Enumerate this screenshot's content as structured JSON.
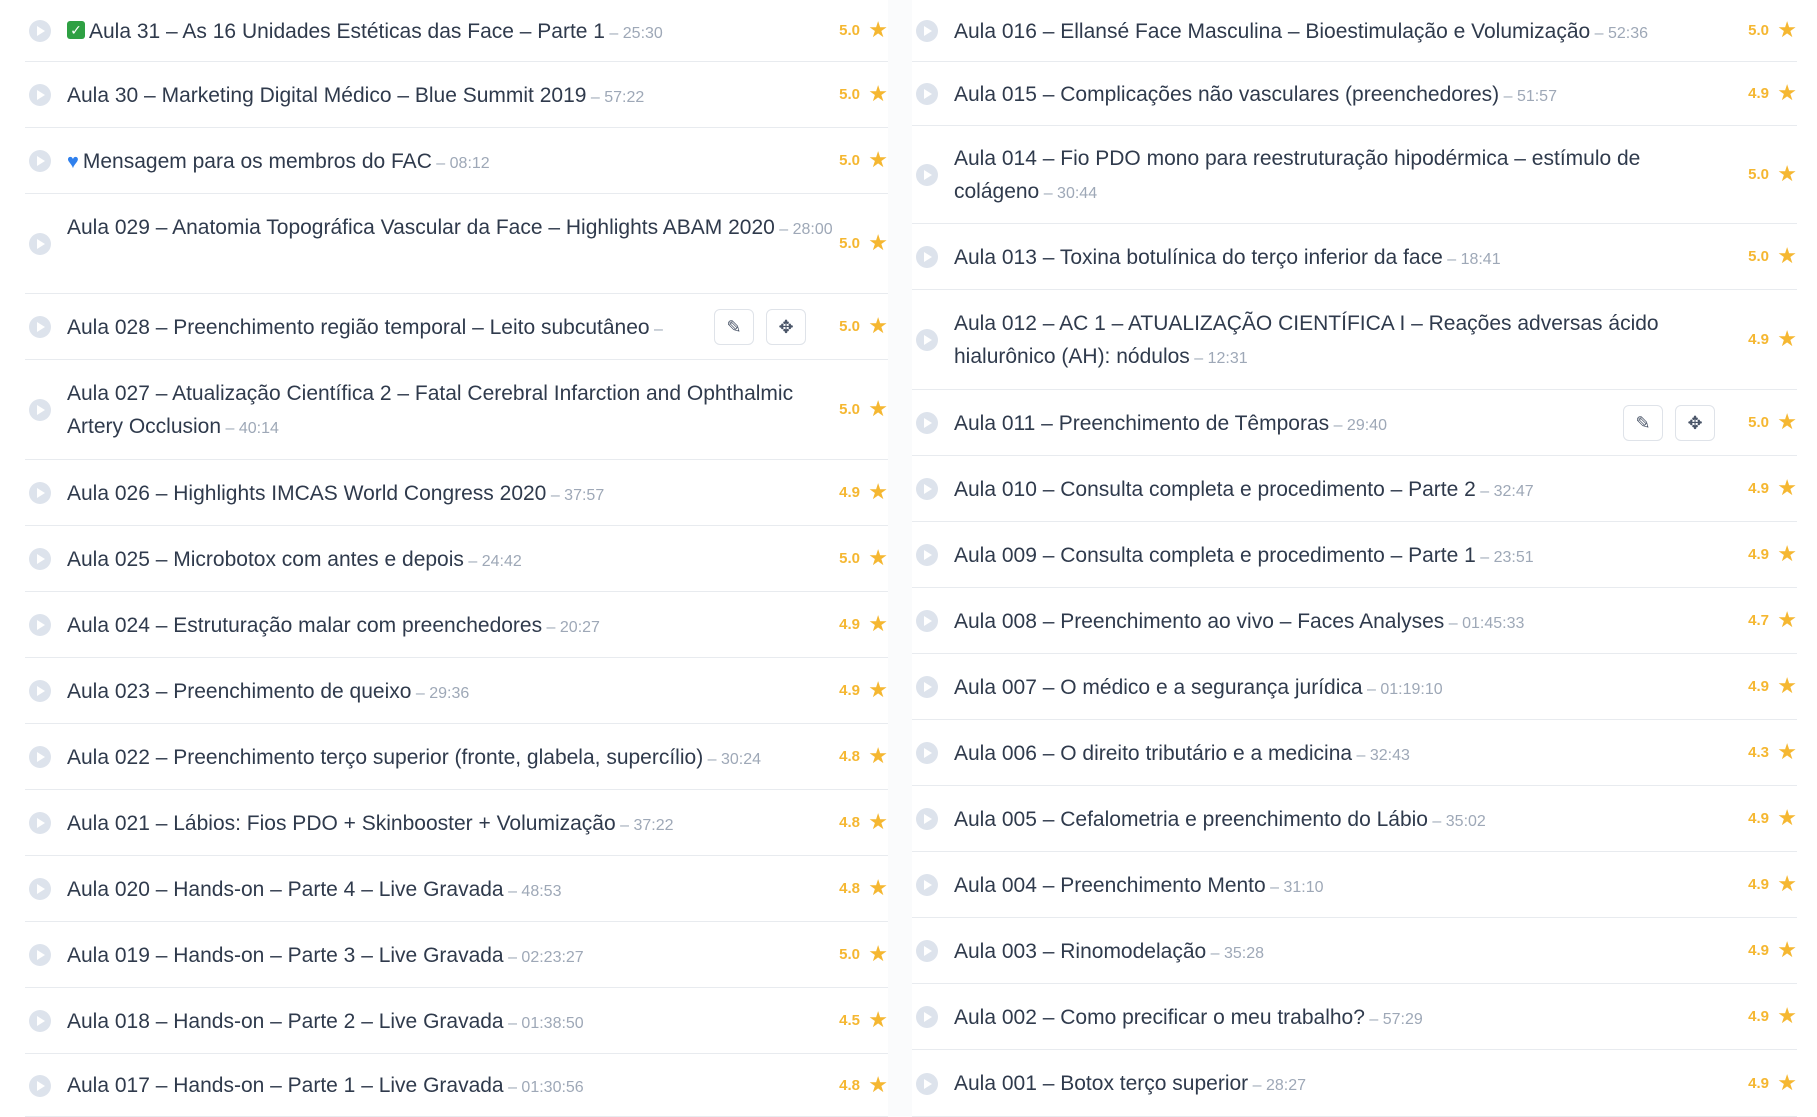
{
  "colors": {
    "accent_star": "#f5b731",
    "text": "#2f3a4c",
    "muted": "#9ea8b7",
    "divider": "#e8ebef"
  },
  "icons": {
    "play": "play-circle-icon",
    "star": "star-icon",
    "edit": "edit-icon",
    "move": "move-icon",
    "check": "check-mark-emoji-icon",
    "heart": "blue-heart-emoji-icon"
  },
  "left_column": [
    {
      "title": "Aula 31 – As 16 Unidades Estéticas das Face – Parte 1",
      "duration": "25:30",
      "rating": "5.0",
      "emoji": "check"
    },
    {
      "title": "Aula 30 – Marketing Digital Médico – Blue Summit 2019",
      "duration": "57:22",
      "rating": "5.0"
    },
    {
      "title": "Mensagem para os membros do FAC",
      "duration": "08:12",
      "rating": "5.0",
      "emoji": "heart"
    },
    {
      "title": "Aula 029 – Anatomia Topográfica Vascular da Face – Highlights ABAM 2020",
      "duration": "28:00",
      "rating": "5.0"
    },
    {
      "title": "Aula 028 – Preenchimento região temporal – Leito subcutâneo",
      "duration": "",
      "rating": "5.0",
      "hover": true
    },
    {
      "title": "Aula 027 – Atualização Científica 2 – Fatal Cerebral Infarction and Ophthalmic Artery Occlusion",
      "duration": "40:14",
      "rating": "5.0"
    },
    {
      "title": "Aula 026 – Highlights IMCAS World Congress 2020",
      "duration": "37:57",
      "rating": "4.9"
    },
    {
      "title": "Aula 025 – Microbotox com antes e depois",
      "duration": "24:42",
      "rating": "5.0"
    },
    {
      "title": "Aula 024 – Estruturação malar com preenchedores",
      "duration": "20:27",
      "rating": "4.9"
    },
    {
      "title": "Aula 023 – Preenchimento de queixo",
      "duration": "29:36",
      "rating": "4.9"
    },
    {
      "title": "Aula 022 – Preenchimento terço superior (fronte, glabela, supercílio)",
      "duration": "30:24",
      "rating": "4.8"
    },
    {
      "title": "Aula 021 – Lábios: Fios PDO + Skinbooster + Volumização",
      "duration": "37:22",
      "rating": "4.8"
    },
    {
      "title": "Aula 020 – Hands-on – Parte 4 – Live Gravada",
      "duration": "48:53",
      "rating": "4.8"
    },
    {
      "title": "Aula 019 – Hands-on – Parte 3 – Live Gravada",
      "duration": "02:23:27",
      "rating": "5.0"
    },
    {
      "title": "Aula 018 – Hands-on – Parte 2 – Live Gravada",
      "duration": "01:38:50",
      "rating": "4.5"
    },
    {
      "title": "Aula 017 – Hands-on – Parte 1 – Live Gravada",
      "duration": "01:30:56",
      "rating": "4.8"
    }
  ],
  "right_column": [
    {
      "title": "Aula 016 – Ellansé Face Masculina – Bioestimulação e Volumização",
      "duration": "52:36",
      "rating": "5.0"
    },
    {
      "title": "Aula 015 – Complicações não vasculares (preenchedores)",
      "duration": "51:57",
      "rating": "4.9"
    },
    {
      "title": "Aula 014 – Fio PDO mono para reestruturação hipodérmica – estímulo de colágeno",
      "duration": "30:44",
      "rating": "5.0"
    },
    {
      "title": "Aula 013 – Toxina botulínica do terço inferior da face",
      "duration": "18:41",
      "rating": "5.0"
    },
    {
      "title": "Aula 012 – AC 1 – ATUALIZAÇÃO CIENTÍFICA I – Reações adversas ácido hialurônico (AH): nódulos",
      "duration": "12:31",
      "rating": "4.9"
    },
    {
      "title": "Aula 011 – Preenchimento de Têmporas",
      "duration": "29:40",
      "rating": "5.0",
      "hover": true
    },
    {
      "title": "Aula 010 – Consulta completa e procedimento – Parte 2",
      "duration": "32:47",
      "rating": "4.9"
    },
    {
      "title": "Aula 009 – Consulta completa e procedimento – Parte 1",
      "duration": "23:51",
      "rating": "4.9"
    },
    {
      "title": "Aula 008 – Preenchimento ao vivo – Faces Analyses",
      "duration": "01:45:33",
      "rating": "4.7"
    },
    {
      "title": "Aula 007 – O médico e a segurança jurídica",
      "duration": "01:19:10",
      "rating": "4.9"
    },
    {
      "title": "Aula 006 – O direito tributário e a medicina",
      "duration": "32:43",
      "rating": "4.3"
    },
    {
      "title": "Aula 005 – Cefalometria e preenchimento do Lábio",
      "duration": "35:02",
      "rating": "4.9"
    },
    {
      "title": "Aula 004 – Preenchimento Mento",
      "duration": "31:10",
      "rating": "4.9"
    },
    {
      "title": "Aula 003 – Rinomodelação",
      "duration": "35:28",
      "rating": "4.9"
    },
    {
      "title": "Aula 002 – Como precificar o meu trabalho?",
      "duration": "57:29",
      "rating": "4.9"
    },
    {
      "title": "Aula 001 – Botox terço superior",
      "duration": "28:27",
      "rating": "4.9"
    }
  ]
}
